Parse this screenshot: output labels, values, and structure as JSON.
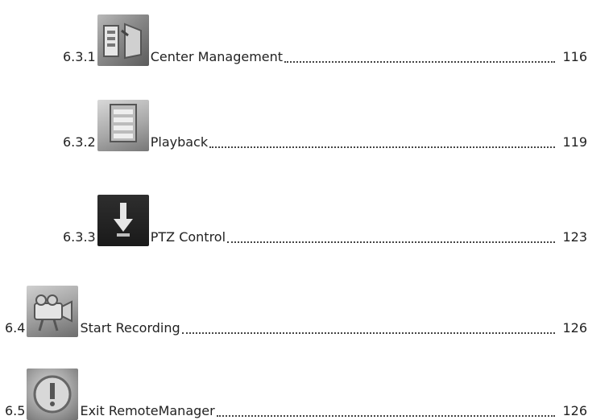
{
  "toc": [
    {
      "number": "6.3.1",
      "icon": "center-management-icon",
      "title": "Center Management",
      "page": "116"
    },
    {
      "number": "6.3.2",
      "icon": "playback-icon",
      "title": "Playback",
      "page": "119"
    },
    {
      "number": "6.3.3",
      "icon": "ptz-control-icon",
      "title": "PTZ Control",
      "page": "123"
    },
    {
      "number": "6.4",
      "icon": "start-recording-icon",
      "title": "Start Recording",
      "page": "126"
    },
    {
      "number": "6.5",
      "icon": "exit-remotemanager-icon",
      "title": "Exit RemoteManager",
      "page": "126"
    }
  ]
}
